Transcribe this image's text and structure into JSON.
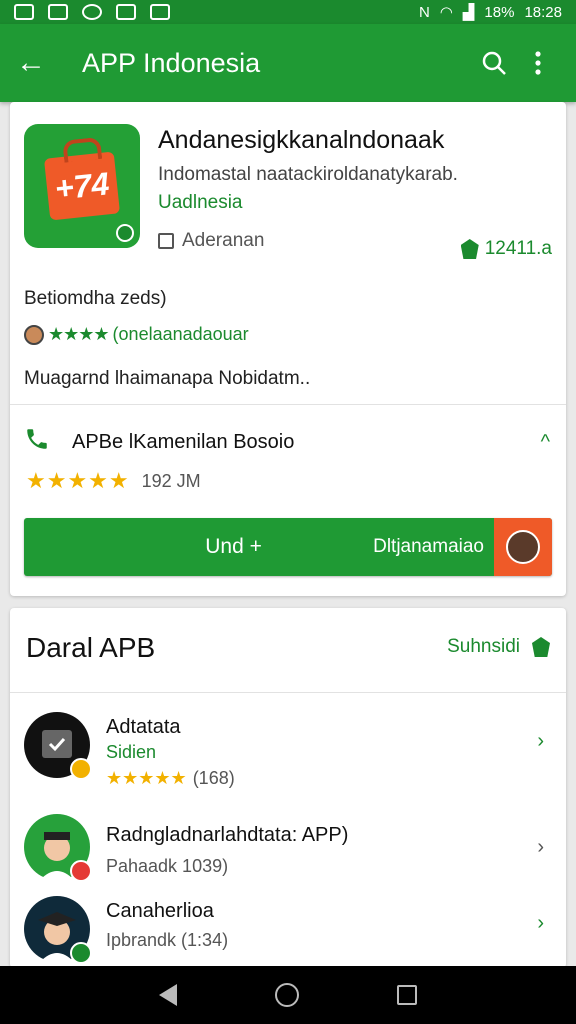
{
  "status_bar": {
    "battery": "18%",
    "time": "18:28",
    "network": "N"
  },
  "app_bar": {
    "title": "APP Indonesia",
    "back_icon": "arrow-left-icon",
    "search_icon": "search-icon",
    "menu_icon": "more-vert-icon"
  },
  "app": {
    "title": "Andanesigkkanalndonaak",
    "subtitle": "Indomastal naatackiroldanatykarab.",
    "developer": "Uadlnesia",
    "category": "Aderanan",
    "rank": "12411.a"
  },
  "reviews": {
    "heading": "Betiomdha zeds)",
    "rating_line": "(onelaanadaouar",
    "description": "Muagarnd lhaimanapa Nobidatm.."
  },
  "contact": {
    "label": "APBe lKamenilan Bosoio"
  },
  "rating": {
    "stars": "★★★★★",
    "count": "192 JM"
  },
  "install": {
    "left_label": "Und +",
    "right_label": "Dltjanamaiao"
  },
  "section": {
    "title": "Daral APB",
    "more_label": "Suhnsidi"
  },
  "list": [
    {
      "name": "Adtatata",
      "sub": "Sidien",
      "stars": "★★★★★",
      "count": "(168)",
      "accent": "#f2b100"
    },
    {
      "name": "Radngladnarlahdtata: APP)",
      "sub": "Pahaadk 1039)",
      "accent": "#e53935"
    },
    {
      "name": "Canaherlioa",
      "sub": "Ipbrandk (1:34)",
      "accent": "#1b8a2e"
    }
  ],
  "colors": {
    "primary": "#1f9a34",
    "status_bar": "#1b8a2e",
    "accent_orange": "#ef5a28",
    "star_gold": "#f2b100"
  }
}
